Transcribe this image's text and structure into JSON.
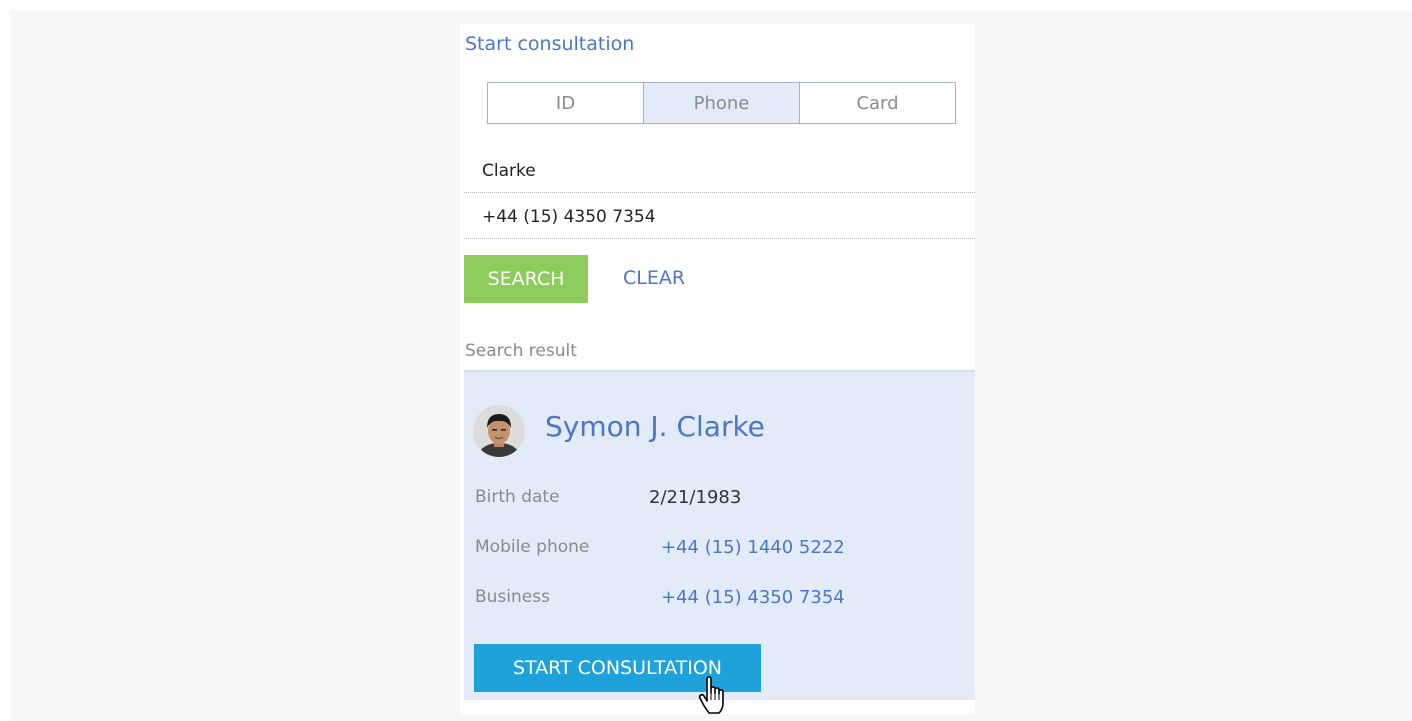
{
  "panel": {
    "title": "Start consultation",
    "search_modes": [
      {
        "label": "ID",
        "active": false
      },
      {
        "label": "Phone",
        "active": true
      },
      {
        "label": "Card",
        "active": false
      }
    ],
    "name_field": {
      "value": "Clarke"
    },
    "phone_field": {
      "value": "+44 (15) 4350 7354"
    },
    "search_label": "SEARCH",
    "clear_label": "CLEAR"
  },
  "results": {
    "label": "Search result",
    "contact": {
      "name": "Symon J. Clarke",
      "fields": [
        {
          "label": "Birth date",
          "value": "2/21/1983"
        },
        {
          "label": "Mobile phone",
          "value": "+44 (15) 1440 5222"
        },
        {
          "label": "Business",
          "value": "+44 (15) 4350 7354"
        }
      ]
    },
    "start_label": "START CONSULTATION"
  },
  "colors": {
    "accent_link": "#4b77c7",
    "search_button": "#8ccb5c",
    "start_button": "#1ea2d9",
    "result_background": "#e3ebf8"
  },
  "icons": {
    "avatar": "user-photo",
    "pointer": "hand-pointer-icon"
  }
}
